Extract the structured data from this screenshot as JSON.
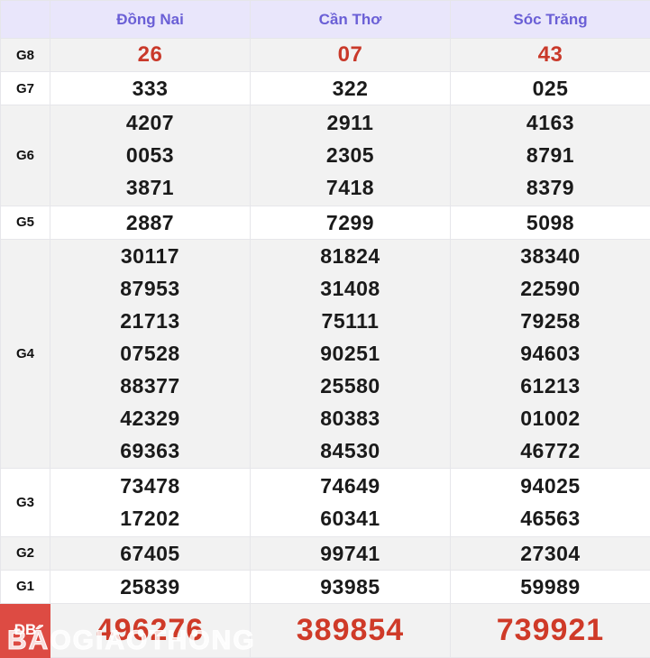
{
  "table": {
    "corner_label": "",
    "columns": [
      "Đồng Nai",
      "Cần Thơ",
      "Sóc Trăng"
    ],
    "row_label_header": "",
    "rows": [
      {
        "label": "G8",
        "values": [
          [
            "26"
          ],
          [
            "07"
          ],
          [
            "43"
          ]
        ]
      },
      {
        "label": "G7",
        "values": [
          [
            "333"
          ],
          [
            "322"
          ],
          [
            "025"
          ]
        ]
      },
      {
        "label": "G6",
        "values": [
          [
            "4207",
            "0053",
            "3871"
          ],
          [
            "2911",
            "2305",
            "7418"
          ],
          [
            "4163",
            "8791",
            "8379"
          ]
        ]
      },
      {
        "label": "G5",
        "values": [
          [
            "2887"
          ],
          [
            "7299"
          ],
          [
            "5098"
          ]
        ]
      },
      {
        "label": "G4",
        "values": [
          [
            "30117",
            "87953",
            "21713",
            "07528",
            "88377",
            "42329",
            "69363"
          ],
          [
            "81824",
            "31408",
            "75111",
            "90251",
            "25580",
            "80383",
            "84530"
          ],
          [
            "38340",
            "22590",
            "79258",
            "94603",
            "61213",
            "01002",
            "46772"
          ]
        ]
      },
      {
        "label": "G3",
        "values": [
          [
            "73478",
            "17202"
          ],
          [
            "74649",
            "60341"
          ],
          [
            "94025",
            "46563"
          ]
        ]
      },
      {
        "label": "G2",
        "values": [
          [
            "67405"
          ],
          [
            "99741"
          ],
          [
            "27304"
          ]
        ]
      },
      {
        "label": "G1",
        "values": [
          [
            "25839"
          ],
          [
            "93985"
          ],
          [
            "59989"
          ]
        ]
      },
      {
        "label": "ĐB",
        "values": [
          [
            "496276"
          ],
          [
            "389854"
          ],
          [
            "739921"
          ]
        ]
      }
    ]
  },
  "watermark": {
    "text": "BÁOGIAOTHONG"
  },
  "colors": {
    "header_bg": "#e9e6fb",
    "header_text": "#6a5fd6",
    "stripe_bg": "#f2f2f2",
    "plain_bg": "#ffffff",
    "number": "#1a1a1a",
    "accent_red": "#c9392a",
    "special_red": "#cf3a28",
    "db_label_bg": "#dd4b43",
    "border": "#e6e6ea"
  }
}
